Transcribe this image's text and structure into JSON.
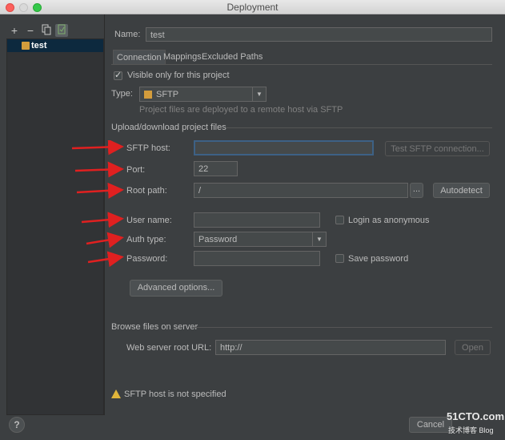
{
  "window": {
    "title": "Deployment"
  },
  "sidebar": {
    "toolbar": {
      "add": "+",
      "remove": "−"
    },
    "items": [
      {
        "label": "test"
      }
    ]
  },
  "name_field": {
    "label": "Name:",
    "value": "test"
  },
  "tabs": [
    {
      "label": "Connection",
      "active": true
    },
    {
      "label": "Mappings",
      "active": false
    },
    {
      "label": "Excluded Paths",
      "active": false
    }
  ],
  "visible_only": {
    "label": "Visible only for this project",
    "checked": true
  },
  "type": {
    "label": "Type:",
    "value": "SFTP",
    "hint": "Project files are deployed to a remote host via SFTP"
  },
  "upload_section": {
    "title": "Upload/download project files"
  },
  "sftp_host": {
    "label": "SFTP host:",
    "value": "",
    "test_button": "Test SFTP connection..."
  },
  "port": {
    "label": "Port:",
    "value": "22"
  },
  "root_path": {
    "label": "Root path:",
    "value": "/",
    "browse": "...",
    "autodetect": "Autodetect"
  },
  "user_name": {
    "label": "User name:",
    "value": "",
    "anonymous_label": "Login as anonymous",
    "anonymous_checked": false
  },
  "auth_type": {
    "label": "Auth type:",
    "value": "Password"
  },
  "password": {
    "label": "Password:",
    "value": "",
    "save_label": "Save password",
    "save_checked": false
  },
  "advanced_button": "Advanced options...",
  "browse_section": {
    "title": "Browse files on server"
  },
  "web_root": {
    "label": "Web server root URL:",
    "value": "http://",
    "open_button": "Open"
  },
  "warning": {
    "text": "SFTP host is not specified"
  },
  "footer": {
    "help": "?",
    "cancel": "Cancel",
    "watermark": "51CTO.com",
    "watermark_sub": "技术博客 Blog"
  },
  "colors": {
    "annotation_arrow": "#e02020",
    "accent": "#3d6185"
  }
}
